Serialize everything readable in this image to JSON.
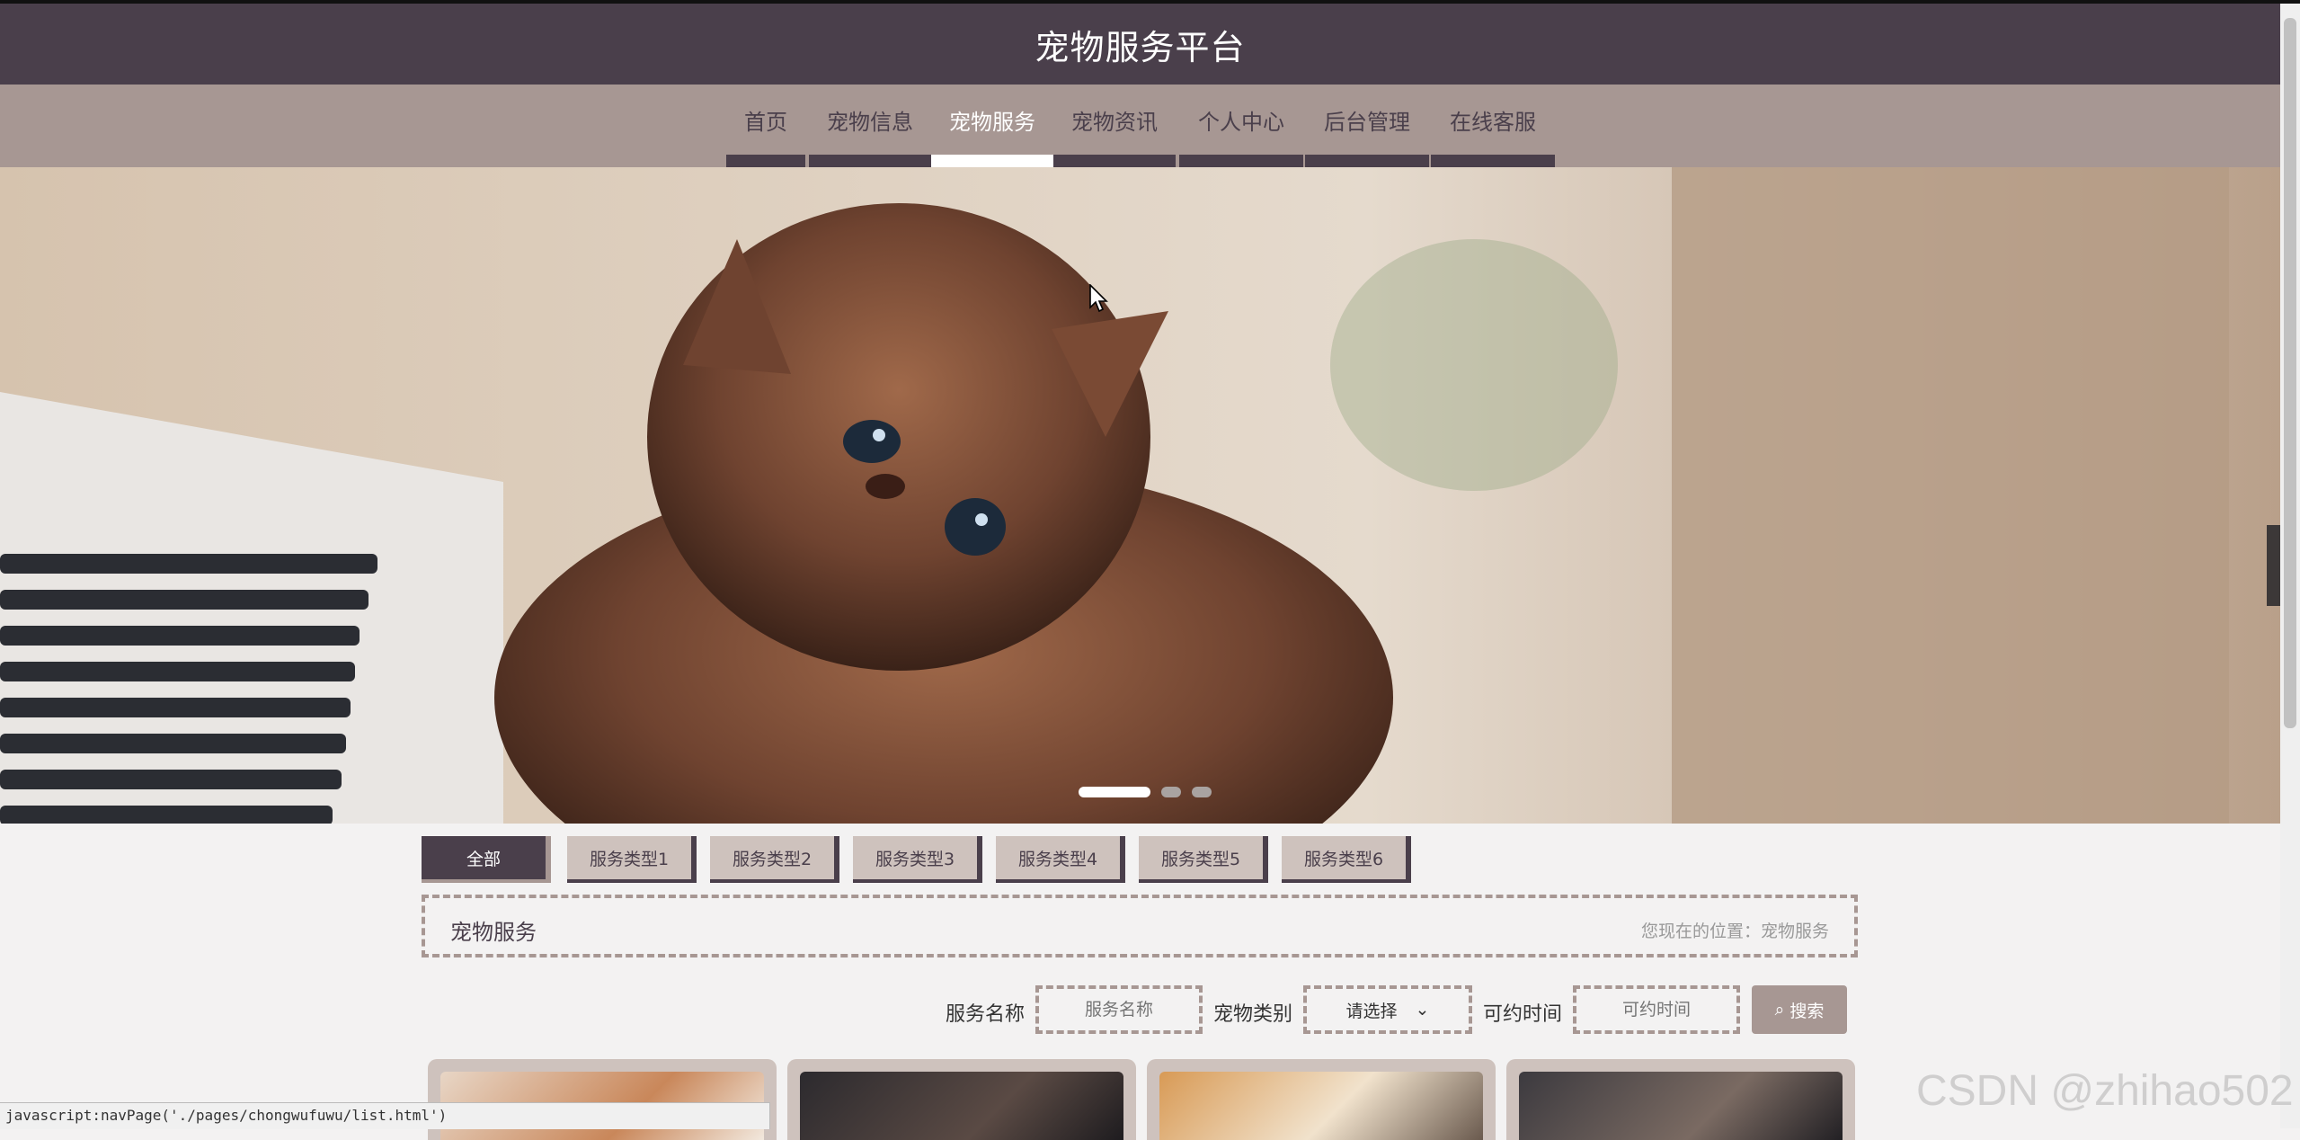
{
  "header": {
    "title": "宠物服务平台"
  },
  "nav": {
    "items": [
      {
        "label": "首页"
      },
      {
        "label": "宠物信息"
      },
      {
        "label": "宠物服务",
        "active": true
      },
      {
        "label": "宠物资讯"
      },
      {
        "label": "个人中心"
      },
      {
        "label": "后台管理"
      },
      {
        "label": "在线客服"
      }
    ]
  },
  "banner": {
    "slide_count": 3,
    "active_slide": 1
  },
  "filter_tabs": [
    "全部",
    "服务类型1",
    "服务类型2",
    "服务类型3",
    "服务类型4",
    "服务类型5",
    "服务类型6"
  ],
  "breadcrumb": {
    "title": "宠物服务",
    "location": "您现在的位置：宠物服务"
  },
  "search": {
    "name_label": "服务名称",
    "name_placeholder": "服务名称",
    "category_label": "宠物类别",
    "category_value": "请选择",
    "time_label": "可约时间",
    "time_placeholder": "可约时间",
    "button_label": "搜索"
  },
  "status_bar": {
    "url": "javascript:navPage('./pages/chongwufuwu/list.html')"
  },
  "watermark": "CSDN @zhihao502",
  "colors": {
    "header": "#4a3f4b",
    "nav": "#a79793",
    "tab": "#cec2bd",
    "background": "#f3f2f2"
  }
}
